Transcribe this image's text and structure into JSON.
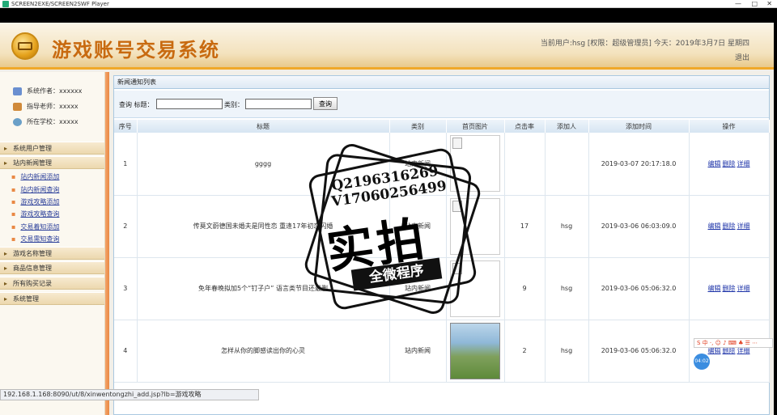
{
  "player": {
    "title": "SCREEN2EXE/SCREEN2SWF Player",
    "controls": [
      "—",
      "□",
      "✕"
    ]
  },
  "header": {
    "title": "游戏账号交易系统",
    "user_info": "当前用户:hsg [权限：超级管理员] 今天：2019年3月7日 星期四",
    "logout": "退出"
  },
  "sidebar": {
    "info": [
      {
        "label": "系统作者：xxxxxx",
        "icon": "users-icon",
        "color": "#6a8fd0"
      },
      {
        "label": "指导老师：xxxxx",
        "icon": "teacher-icon",
        "color": "#d08a3a"
      },
      {
        "label": "所在学校：xxxxx",
        "icon": "school-icon",
        "color": "#6aa0c8"
      }
    ],
    "menu": {
      "user_mgmt": "系统用户管理",
      "news_mgmt": "站内新闻管理",
      "news_subs": [
        "站内新闻添加",
        "站内新闻查询",
        "游戏攻略添加",
        "游戏攻略查询",
        "交易着知添加",
        "交易需知查询"
      ],
      "game_mgmt": "游戏名称管理",
      "goods_mgmt": "商品信息管理",
      "orders": "所有购买记录",
      "system": "系统管理"
    }
  },
  "main": {
    "panel_title": "新闻通知列表",
    "search": {
      "label_query": "查询 标题：",
      "label_type": "类别：",
      "button": "查询",
      "title_value": "",
      "type_value": ""
    },
    "columns": [
      "序号",
      "标题",
      "类别",
      "首页图片",
      "点击率",
      "添加人",
      "添加时间",
      "操作"
    ],
    "rows": [
      {
        "no": "1",
        "title": "gggg",
        "type": "站内新闻",
        "clicks": "",
        "adder": "",
        "time": "2019-03-07 20:17:18.0",
        "image": "broken"
      },
      {
        "no": "2",
        "title": "传莫文蔚德国未婚夫是同性恋 重逢17年初恋闪婚",
        "type": "站内新闻",
        "clicks": "17",
        "adder": "hsg",
        "time": "2019-03-06 06:03:09.0",
        "image": "broken"
      },
      {
        "no": "3",
        "title": "免年春晚拟加5个“钉子户” 语言类节目还最删",
        "type": "站内新闻",
        "clicks": "9",
        "adder": "hsg",
        "time": "2019-03-06 05:06:32.0",
        "image": "broken"
      },
      {
        "no": "4",
        "title": "怎样从你的脚感读出你的心灵",
        "type": "站内新闻",
        "clicks": "2",
        "adder": "hsg",
        "time": "2019-03-06 05:06:32.0",
        "image": "photo"
      }
    ],
    "actions": [
      "编辑",
      "删除",
      "详细"
    ]
  },
  "watermark": {
    "qq": "Q2196316269",
    "vx": "V17060256499",
    "big": "实拍",
    "band": "全微程序"
  },
  "statusbar": {
    "url": "192.168.1.168:8090/ut/8/xinwentongzhi_add.jsp?lb=游戏攻略"
  },
  "ime": {
    "label": "S 中 ·, ☺ ♪ ⌨ ♣ ☰ ⋯"
  },
  "clock": {
    "time": "04:02"
  }
}
